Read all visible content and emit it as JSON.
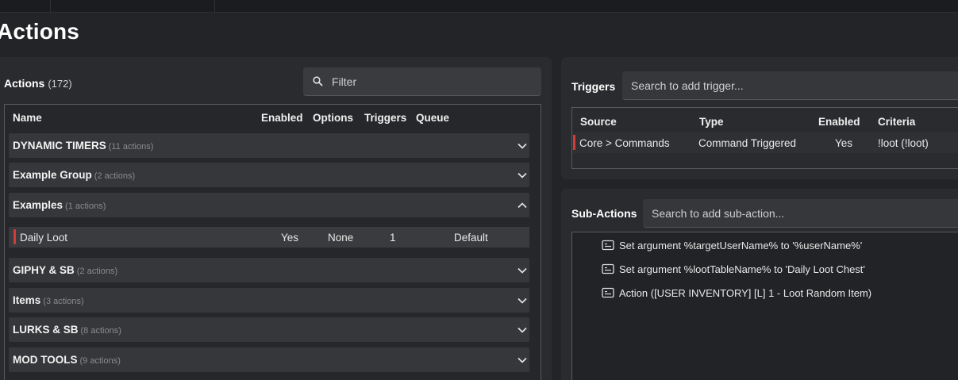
{
  "page": {
    "title": "Actions"
  },
  "actions_panel": {
    "label": "Actions",
    "count": "(172)",
    "filter_placeholder": "Filter",
    "columns": [
      "Name",
      "Enabled",
      "Options",
      "Triggers",
      "Queue"
    ],
    "groups": [
      {
        "name": "DYNAMIC TIMERS",
        "count": "(11 actions)",
        "expanded": false
      },
      {
        "name": "Example Group",
        "count": "(2 actions)",
        "expanded": false
      },
      {
        "name": "Examples",
        "count": "(1 actions)",
        "expanded": true
      },
      {
        "name": "GIPHY & SB",
        "count": "(2 actions)",
        "expanded": false
      },
      {
        "name": "Items",
        "count": "(3 actions)",
        "expanded": false
      },
      {
        "name": "LURKS & SB",
        "count": "(8 actions)",
        "expanded": false
      },
      {
        "name": "MOD TOOLS",
        "count": "(9 actions)",
        "expanded": false
      }
    ],
    "selected_action": {
      "name": "Daily Loot",
      "enabled": "Yes",
      "options": "None",
      "triggers": "1",
      "queue": "Default"
    }
  },
  "triggers_panel": {
    "label": "Triggers",
    "search_placeholder": "Search to add trigger...",
    "columns": [
      "Source",
      "Type",
      "Enabled",
      "Criteria"
    ],
    "rows": [
      {
        "source": "Core > Commands",
        "type": "Command Triggered",
        "enabled": "Yes",
        "criteria": "!loot (!loot)"
      }
    ]
  },
  "subactions_panel": {
    "label": "Sub-Actions",
    "search_placeholder": "Search to add sub-action...",
    "items": [
      {
        "text": "Set argument %targetUserName% to '%userName%'",
        "icon": "subaction-icon"
      },
      {
        "text": "Set argument %lootTableName% to 'Daily Loot Chest'",
        "icon": "subaction-icon"
      },
      {
        "text": "Action ([USER INVENTORY] [L] 1 - Loot Random Item)",
        "icon": "subaction-icon"
      }
    ]
  },
  "colors": {
    "accent_marker": "#d33a3a",
    "background": "#232427",
    "panel": "#2a2b2e"
  }
}
